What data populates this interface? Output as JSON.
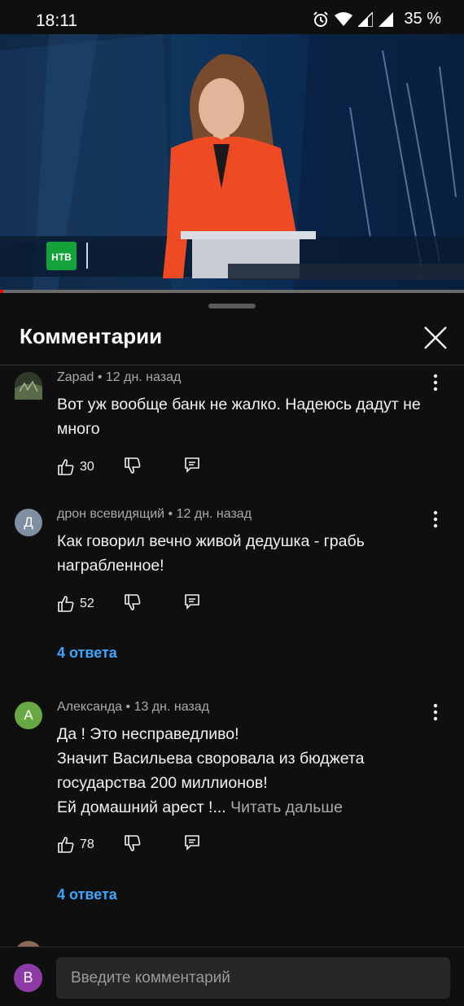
{
  "status_bar": {
    "time": "18:11",
    "battery": "35 %"
  },
  "video": {
    "channel_logo_text": "НТВ",
    "progress_fraction": 0.007
  },
  "sheet": {
    "title": "Комментарии"
  },
  "comments": [
    {
      "avatar_letter": "",
      "avatar_color": "#4a5a3a",
      "author": "Zapad",
      "time": "12 дн. назад",
      "text": "Вот уж вообще банк не жалко. Надеюсь дадут не много",
      "read_more": "",
      "likes": "30",
      "replies": ""
    },
    {
      "avatar_letter": "Д",
      "avatar_color": "#7d8fa0",
      "author": "дрон всевидящий",
      "time": "12 дн. назад",
      "text": "Как говорил вечно живой дедушка - грабь награбленное!",
      "read_more": "",
      "likes": "52",
      "replies": "4 ответа"
    },
    {
      "avatar_letter": "А",
      "avatar_color": "#67a843",
      "author": "Александа",
      "time": "13 дн. назад",
      "text": "Да ! Это несправедливо!\nЗначит Васильева своровала из бюджета государства 200 миллионов!\nЕй домашний арест !...",
      "read_more": "Читать дальше",
      "likes": "78",
      "replies": "4 ответа"
    }
  ],
  "input": {
    "avatar_letter": "В",
    "placeholder": "Введите комментарий"
  },
  "colors": {
    "accent_link": "#3ea6ff",
    "progress": "#ff0000",
    "background": "#0f0f0f"
  }
}
